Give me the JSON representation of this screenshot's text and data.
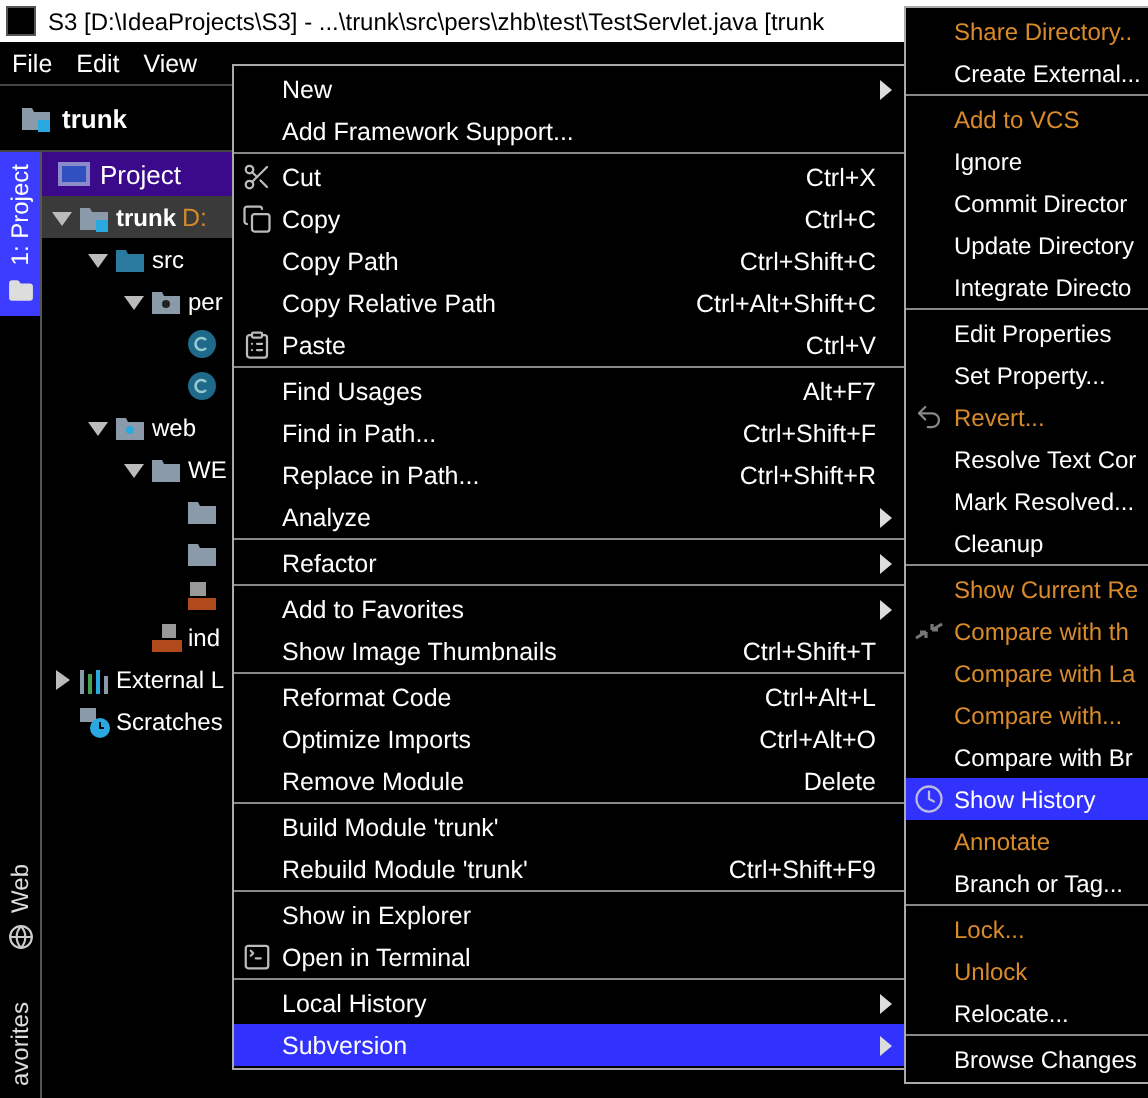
{
  "window": {
    "title": "S3 [D:\\IdeaProjects\\S3] - ...\\trunk\\src\\pers\\zhb\\test\\TestServlet.java [trunk"
  },
  "menu_bar": [
    "File",
    "Edit",
    "View"
  ],
  "navigation": {
    "label": "trunk"
  },
  "tool_strip": [
    {
      "label": "1: Project",
      "selected": true
    },
    {
      "label": "Web",
      "selected": false
    },
    {
      "label": "avorites",
      "selected": false
    }
  ],
  "project_panel": {
    "view_selector": "Project",
    "tree": [
      {
        "label": "trunk",
        "path": "D:",
        "kind": "module",
        "expanded": true,
        "selected": true,
        "children": [
          {
            "label": "src",
            "kind": "source",
            "expanded": true,
            "selected": false,
            "children": [
              {
                "label": "per",
                "kind": "package",
                "expanded": true,
                "selected": false,
                "children": [
                  {
                    "kind": "class",
                    "selected": false
                  },
                  {
                    "kind": "class",
                    "selected": false
                  }
                ]
              }
            ]
          },
          {
            "label": "web",
            "kind": "webfolder",
            "expanded": true,
            "selected": false,
            "children": [
              {
                "label": "WE",
                "kind": "folder",
                "expanded": true,
                "selected": false,
                "children": [
                  {
                    "kind": "folder",
                    "selected": false
                  },
                  {
                    "kind": "folder",
                    "selected": false
                  },
                  {
                    "kind": "xml",
                    "selected": false
                  }
                ]
              },
              {
                "label": "ind",
                "kind": "jsp",
                "selected": false
              }
            ]
          }
        ]
      },
      {
        "label": "External L",
        "kind": "libraries",
        "expanded": false,
        "selected": false
      },
      {
        "label": "Scratches",
        "kind": "scratches",
        "selected": false
      }
    ]
  },
  "context_menu": {
    "groups": [
      [
        {
          "label": "New",
          "submenu": true,
          "selected": false
        },
        {
          "label": "Add Framework Support...",
          "selected": false
        }
      ],
      [
        {
          "label": "Cut",
          "shortcut": "Ctrl+X",
          "kind": "scissors",
          "selected": false
        },
        {
          "label": "Copy",
          "shortcut": "Ctrl+C",
          "kind": "copy",
          "selected": false
        },
        {
          "label": "Copy Path",
          "shortcut": "Ctrl+Shift+C",
          "selected": false
        },
        {
          "label": "Copy Relative Path",
          "shortcut": "Ctrl+Alt+Shift+C",
          "selected": false
        },
        {
          "label": "Paste",
          "shortcut": "Ctrl+V",
          "kind": "paste",
          "selected": false
        }
      ],
      [
        {
          "label": "Find Usages",
          "shortcut": "Alt+F7",
          "selected": false
        },
        {
          "label": "Find in Path...",
          "shortcut": "Ctrl+Shift+F",
          "selected": false
        },
        {
          "label": "Replace in Path...",
          "shortcut": "Ctrl+Shift+R",
          "selected": false
        },
        {
          "label": "Analyze",
          "submenu": true,
          "selected": false
        }
      ],
      [
        {
          "label": "Refactor",
          "submenu": true,
          "selected": false
        }
      ],
      [
        {
          "label": "Add to Favorites",
          "submenu": true,
          "selected": false
        },
        {
          "label": "Show Image Thumbnails",
          "shortcut": "Ctrl+Shift+T",
          "selected": false
        }
      ],
      [
        {
          "label": "Reformat Code",
          "shortcut": "Ctrl+Alt+L",
          "selected": false
        },
        {
          "label": "Optimize Imports",
          "shortcut": "Ctrl+Alt+O",
          "selected": false
        },
        {
          "label": "Remove Module",
          "shortcut": "Delete",
          "selected": false
        }
      ],
      [
        {
          "label": "Build Module 'trunk'",
          "selected": false
        },
        {
          "label": "Rebuild Module 'trunk'",
          "shortcut": "Ctrl+Shift+F9",
          "selected": false
        }
      ],
      [
        {
          "label": "Show in Explorer",
          "selected": false
        },
        {
          "label": "Open in Terminal",
          "kind": "terminal",
          "selected": false
        }
      ],
      [
        {
          "label": "Local History",
          "submenu": true,
          "selected": false
        },
        {
          "label": "Subversion",
          "submenu": true,
          "selected": true
        }
      ]
    ]
  },
  "subversion_menu": {
    "groups": [
      [
        {
          "label": "Share Directory..",
          "disabled": true,
          "selected": false
        },
        {
          "label": "Create External...",
          "disabled": false,
          "selected": false
        }
      ],
      [
        {
          "label": "Add to VCS",
          "disabled": true,
          "selected": false
        },
        {
          "label": "Ignore",
          "disabled": false,
          "selected": false
        },
        {
          "label": "Commit Director",
          "disabled": false,
          "selected": false
        },
        {
          "label": "Update Directory",
          "disabled": false,
          "selected": false
        },
        {
          "label": "Integrate Directo",
          "disabled": false,
          "selected": false
        }
      ],
      [
        {
          "label": "Edit Properties",
          "disabled": false,
          "selected": false
        },
        {
          "label": "Set Property...",
          "disabled": false,
          "selected": false
        },
        {
          "label": "Revert...",
          "disabled": true,
          "kind": "revert",
          "selected": false
        },
        {
          "label": "Resolve Text Cor",
          "disabled": false,
          "selected": false
        },
        {
          "label": "Mark Resolved...",
          "disabled": false,
          "selected": false
        },
        {
          "label": "Cleanup",
          "disabled": false,
          "selected": false
        }
      ],
      [
        {
          "label": "Show Current Re",
          "disabled": true,
          "selected": false
        },
        {
          "label": "Compare with th",
          "disabled": true,
          "kind": "compare",
          "selected": false
        },
        {
          "label": "Compare with La",
          "disabled": true,
          "selected": false
        },
        {
          "label": "Compare with...",
          "disabled": true,
          "selected": false
        },
        {
          "label": "Compare with Br",
          "disabled": false,
          "selected": false
        },
        {
          "label": "Show History",
          "disabled": false,
          "kind": "history",
          "selected": true
        },
        {
          "label": "Annotate",
          "disabled": true,
          "selected": false
        },
        {
          "label": "Branch or Tag...",
          "disabled": false,
          "selected": false
        }
      ],
      [
        {
          "label": "Lock...",
          "disabled": true,
          "selected": false
        },
        {
          "label": "Unlock",
          "disabled": true,
          "selected": false
        },
        {
          "label": "Relocate...",
          "disabled": false,
          "selected": false
        }
      ],
      [
        {
          "label": "Browse Changes",
          "disabled": false,
          "selected": false
        }
      ]
    ]
  }
}
